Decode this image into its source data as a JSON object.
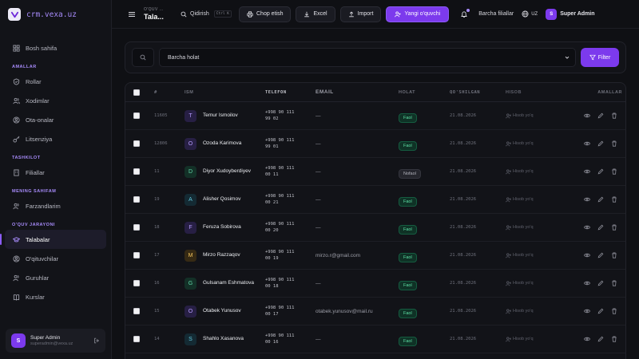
{
  "brand": {
    "name": "crm.vexa.uz"
  },
  "sidebar": {
    "home": "Bosh sahifa",
    "sections": {
      "amallar": "AMALLAR",
      "tashkilot": "TASHKILOT",
      "mening": "MENING SAHIFAM",
      "oquv": "O'QUV JARAYONI"
    },
    "items": {
      "rollar": "Rollar",
      "xodimlar": "Xodimlar",
      "ota_onalar": "Ota-onalar",
      "litsenziya": "Litsenziya",
      "filiallar": "Filiallar",
      "farzandlarim": "Farzandlarim",
      "talabalar": "Talabalar",
      "oqituvchilar": "O'qituvchilar",
      "guruhlar": "Guruhlar",
      "kurslar": "Kurslar"
    },
    "user": {
      "name": "Super Admin",
      "email": "superadmin@vexa.uz",
      "initial": "S"
    }
  },
  "topbar": {
    "crumb_parent": "O'QUV ...",
    "crumb_title": "Tala...",
    "search_label": "Qidirish",
    "search_kbd": "Ctrl K",
    "print_label": "Chop etish",
    "excel_label": "Excel",
    "import_label": "Import",
    "new_label": "Yangi o'quvchi",
    "branch_label": "Barcha filiallar",
    "lang": "UZ",
    "admin_name": "Super Admin",
    "admin_initial": "S"
  },
  "filter": {
    "status_selected": "Barcha holat",
    "filter_label": "Filter"
  },
  "table": {
    "headers": {
      "num": "#",
      "name": "ISM",
      "phone": "TELEFON",
      "email": "EMAIL",
      "status": "HOLAT",
      "joined": "QO'SHILGAN",
      "account": "HISOB",
      "actions": "AMALLAR"
    },
    "rows": [
      {
        "num": "11605",
        "initial": "T",
        "name": "Temur Ismoilov",
        "phone1": "+998 90 111",
        "phone2": "99 02",
        "email": "—",
        "status": "Faol",
        "date": "21.08.2026",
        "account": "Hisob yo'q"
      },
      {
        "num": "12806",
        "initial": "O",
        "name": "Ozoda Karimova",
        "phone1": "+998 90 111",
        "phone2": "99 01",
        "email": "—",
        "status": "Faol",
        "date": "21.08.2026",
        "account": "Hisob yo'q"
      },
      {
        "num": "11",
        "initial": "D",
        "name": "Diyor Xudoyberdiyev",
        "phone1": "+998 90 111",
        "phone2": "00 11",
        "email": "—",
        "status": "Nofaol",
        "date": "21.08.2026",
        "account": "Hisob yo'q"
      },
      {
        "num": "19",
        "initial": "A",
        "name": "Alisher Qosimov",
        "phone1": "+998 90 111",
        "phone2": "00 21",
        "email": "—",
        "status": "Faol",
        "date": "21.08.2026",
        "account": "Hisob yo'q"
      },
      {
        "num": "18",
        "initial": "F",
        "name": "Feruza Sobirova",
        "phone1": "+998 90 111",
        "phone2": "00 20",
        "email": "—",
        "status": "Faol",
        "date": "21.08.2026",
        "account": "Hisob yo'q"
      },
      {
        "num": "17",
        "initial": "M",
        "name": "Mirzo Razzaqov",
        "phone1": "+998 90 111",
        "phone2": "00 19",
        "email": "mirzo.r@gmail.com",
        "status": "Faol",
        "date": "21.08.2026",
        "account": "Hisob yo'q"
      },
      {
        "num": "16",
        "initial": "G",
        "name": "Gulsanam Eshmatova",
        "phone1": "+998 90 111",
        "phone2": "00 18",
        "email": "—",
        "status": "Faol",
        "date": "21.08.2026",
        "account": "Hisob yo'q"
      },
      {
        "num": "15",
        "initial": "O",
        "name": "Otabek Yunusov",
        "phone1": "+998 90 111",
        "phone2": "00 17",
        "email": "otabek.yunusov@mail.ru",
        "status": "Faol",
        "date": "21.08.2026",
        "account": "Hisob yo'q"
      },
      {
        "num": "14",
        "initial": "S",
        "name": "Shahlo Xasanova",
        "phone1": "+998 90 111",
        "phone2": "00 16",
        "email": "—",
        "status": "Faol",
        "date": "21.08.2026",
        "account": "Hisob yo'q"
      }
    ]
  },
  "colors": {
    "accent": "#7c3aed",
    "active_badge": "#5fe0a6",
    "inactive_badge": "#b4b5be"
  }
}
